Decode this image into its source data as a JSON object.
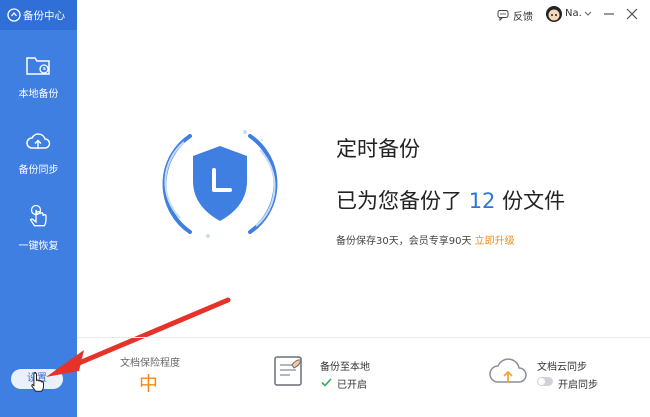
{
  "app": {
    "title": "备份中心"
  },
  "topbar": {
    "feedback_label": "反馈",
    "user_name": "Na."
  },
  "sidebar": {
    "items": [
      {
        "label": "本地备份"
      },
      {
        "label": "备份同步"
      },
      {
        "label": "一键恢复"
      }
    ],
    "settings_label": "设置"
  },
  "main": {
    "title": "定时备份",
    "status_prefix": "已为您备份了",
    "count": "12",
    "status_suffix": "份文件",
    "retention_note": "备份保存30天，会员专享90天",
    "upgrade_link": "立即升级"
  },
  "bottom": {
    "protection": {
      "label": "文档保险程度",
      "level": "中"
    },
    "local": {
      "label": "备份至本地",
      "status": "已开启"
    },
    "cloud": {
      "label": "文档云同步",
      "toggle_label": "开启同步"
    }
  },
  "colors": {
    "sidebar": "#3f7fe2",
    "accent": "#2f74d8",
    "highlight": "#f08a1c",
    "success": "#2fae5a"
  }
}
